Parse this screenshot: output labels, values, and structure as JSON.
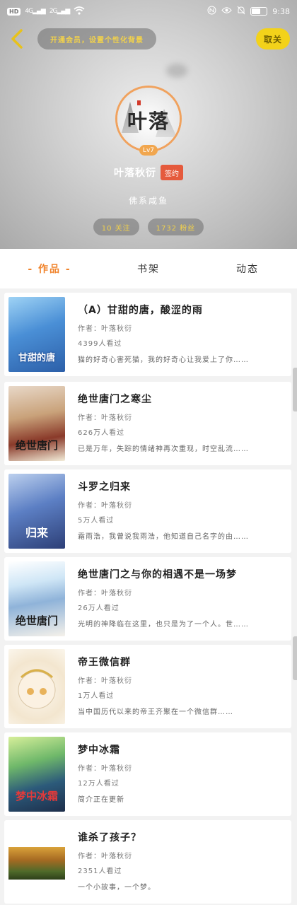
{
  "status_bar": {
    "left_chip": "HD",
    "signal_1": "4G",
    "signal_2": "2G",
    "time": "9:38"
  },
  "header": {
    "vip_prompt": "开通会员，设置个性化背景",
    "follow_label": "取关",
    "avatar_text": "叶落",
    "level": "Lv7",
    "username": "叶落秋衍",
    "signed_badge": "签约",
    "motto": "佛系咸鱼",
    "stats": [
      "10 关注",
      "1732 粉丝"
    ]
  },
  "tabs": [
    {
      "label": "- 作品 -",
      "active": true
    },
    {
      "label": "书架",
      "active": false
    },
    {
      "label": "动态",
      "active": false
    }
  ],
  "books": [
    {
      "title": "（A）甘甜的唐，酸涩的雨",
      "author": "作者：叶落秋衍",
      "views": "4399人看过",
      "desc": "猫的好奇心害死猫，我的好奇心让我爱上了你……",
      "cover_text": "甘甜的唐"
    },
    {
      "title": "绝世唐门之寒尘",
      "author": "作者：叶落秋衍",
      "views": "626万人看过",
      "desc": "已是万年，失踪的情绪神再次重现，时空乱流……",
      "cover_text": "绝世唐门"
    },
    {
      "title": "斗罗之归来",
      "author": "作者：叶落秋衍",
      "views": "5万人看过",
      "desc": "霜雨浩，我曾说我雨浩，他知道自己名字的由……",
      "cover_text": "归来"
    },
    {
      "title": "绝世唐门之与你的相遇不是一场梦",
      "author": "作者：叶落秋衍",
      "views": "26万人看过",
      "desc": "光明的神降临在这里，也只是为了一个人。世……",
      "cover_text": "绝世唐门"
    },
    {
      "title": "帝王微信群",
      "author": "作者：叶落秋衍",
      "views": "1万人看过",
      "desc": "当中国历代以来的帝王齐聚在一个微信群……",
      "cover_text": ""
    },
    {
      "title": "梦中冰霜",
      "author": "作者：叶落秋衍",
      "views": "12万人看过",
      "desc": "简介正在更新",
      "cover_text": "梦中冰霜"
    },
    {
      "title": "谁杀了孩子？",
      "author": "作者：叶落秋衍",
      "views": "2351人看过",
      "desc": "一个小故事，一个梦。",
      "cover_text": ""
    }
  ]
}
